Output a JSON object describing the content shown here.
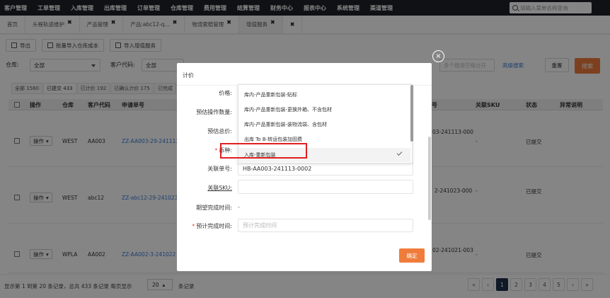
{
  "topnav": {
    "menu": [
      "客户管理",
      "工单管理",
      "入库管理",
      "出库管理",
      "订单管理",
      "仓库管理",
      "费用管理",
      "结算管理",
      "财务中心",
      "报表中心",
      "系统管理",
      "渠道管理"
    ],
    "search_placeholder": "请输入菜单名称查询"
  },
  "tabs": [
    {
      "label": "首页",
      "closable": false
    },
    {
      "label": "头程轨迹维护",
      "closable": true
    },
    {
      "label": "产品管理",
      "closable": true
    },
    {
      "label": "产品:abc12-q...",
      "closable": true
    },
    {
      "label": "物流索赔管理",
      "closable": true
    },
    {
      "label": "增值服务",
      "closable": true,
      "active": true
    },
    {
      "label": "",
      "closable": true
    }
  ],
  "toolbar": {
    "export": "导出",
    "batch_import": "批量导入仓库成本",
    "import_vas": "导入增值服务"
  },
  "filters": {
    "warehouse_label": "仓库:",
    "warehouse_value": "全部",
    "customer_label": "客户代码:",
    "customer_value": "全部",
    "multi_placeholder": "多个搜用空格分开",
    "advanced": "高级搜索",
    "reset": "重置",
    "search": "搜索"
  },
  "status_tabs": [
    "全部 1560",
    "已提交 433",
    "已计价 192",
    "已确认计价 175",
    "已完成"
  ],
  "table": {
    "headers": [
      "操作",
      "仓库",
      "客户代码",
      "申请单号",
      "号",
      "关联SKU",
      "状态",
      "异常说明"
    ],
    "rows": [
      {
        "op": "操作",
        "warehouse": "WEST",
        "customer": "AA003",
        "order": "ZZ-AA003-29-241113",
        "ref": "03-241113-000",
        "sku": "-",
        "status": "已提交"
      },
      {
        "op": "操作",
        "warehouse": "WEST",
        "customer": "abc12",
        "order": "ZZ-abc12-29-241023",
        "ref": "2-241023-000",
        "sku": "-",
        "status": "已提交"
      },
      {
        "op": "操作",
        "warehouse": "WPLA",
        "customer": "AA002",
        "order": "ZZ-AA002-3-241022",
        "ref": "02-241021-003",
        "sku": "-",
        "status": "已提交"
      }
    ]
  },
  "footer": {
    "info": "显示第 1 到第 20 条记录，总共 433 条记录 每页显示",
    "page_size": "20",
    "suffix": "条记录",
    "pages": [
      "«",
      "‹",
      "1",
      "2",
      "3",
      "4",
      "5",
      "›",
      "»"
    ],
    "active_page": "1"
  },
  "modal": {
    "title": "计价",
    "price_label": "价格:",
    "estimate_qty_label": "预估操作数量:",
    "estimate_total_label": "预估总价:",
    "type_label": "币种:",
    "ref_no_label": "关联单号:",
    "ref_no_value": "HB-AA003-241113-0002",
    "ref_sku_label": "关联SKU:",
    "expected_finish_label": "期望完成时间:",
    "expected_finish_value": "-",
    "planned_finish_label": "预计完成时间:",
    "planned_finish_placeholder": "预计完成时间",
    "confirm": "确定"
  },
  "dropdown": {
    "items": [
      "库内-产品重新包装-贴标",
      "库内-产品重新包装-更换外箱、不含包材",
      "库内-产品重新包装-装物流袋、含包材",
      "出库 To B-转运包装加固费",
      "入库-重新包装"
    ],
    "selected": "入库-重新包装"
  },
  "colors": {
    "nav_bg": "#1f2227",
    "accent": "#f07c3c",
    "link": "#3a7bd5",
    "highlight": "#e02020"
  }
}
